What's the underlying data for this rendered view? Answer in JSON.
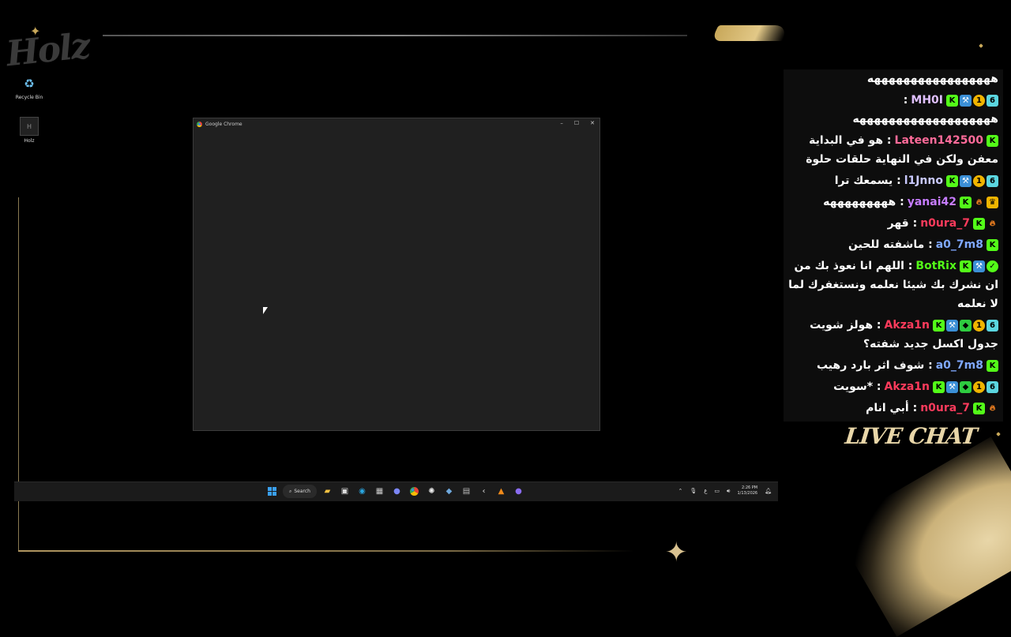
{
  "overlay": {
    "brand": "Holz",
    "live_chat_label": "LIVE CHAT"
  },
  "desktop": {
    "icons": [
      {
        "label": "Recycle Bin",
        "icon": "recycle-bin-icon"
      },
      {
        "label": "Holz",
        "icon": "holz-app-icon"
      }
    ]
  },
  "window": {
    "title": "Google Chrome",
    "controls": [
      "–",
      "☐",
      "✕"
    ]
  },
  "taskbar": {
    "search_label": "Search",
    "apps": [
      "file-explorer-icon",
      "store-icon",
      "edge-icon",
      "calculator-icon",
      "discord-icon",
      "chrome-icon",
      "obs-icon",
      "steam-icon",
      "keyboard-icon",
      "back-icon",
      "app-a-icon",
      "app-circle-icon"
    ],
    "tray_lang": "ع",
    "time": "2:26 PM",
    "date": "1/13/2026"
  },
  "chat": {
    "messages": [
      {
        "badges": [],
        "user": "",
        "user_color": "#ffffff",
        "text": "هههههههههههههههههه"
      },
      {
        "badges": [
          "kick",
          "blue",
          "gold",
          "cyan"
        ],
        "user": "MH0I",
        "user_color": "#e0c0ff",
        "text": "هههههههههههههههههههه"
      },
      {
        "badges": [
          "kick"
        ],
        "user": "Lateen142500",
        "user_color": "#ff6b9a",
        "text": "هو في البداية معفن ولكن في النهاية حلقات حلوة"
      },
      {
        "badges": [
          "kick",
          "blue",
          "gold",
          "cyan"
        ],
        "user": "l1Jnno",
        "user_color": "#c9c9ff",
        "text": "يسمعك ترا"
      },
      {
        "badges": [
          "kick",
          "flame",
          "crown"
        ],
        "user": "yanai42",
        "user_color": "#c77dff",
        "text": "هههههههههه"
      },
      {
        "badges": [
          "kick",
          "flame"
        ],
        "user": "n0ura_7",
        "user_color": "#ff3b5c",
        "text": "قهر"
      },
      {
        "badges": [
          "kick"
        ],
        "user": "a0_7m8",
        "user_color": "#7fa8ff",
        "text": "ماشفته للحين"
      },
      {
        "badges": [
          "kick",
          "blue",
          "shield"
        ],
        "user": "BotRix",
        "user_color": "#53fc18",
        "text": "اللهم انا نعوذ بك من ان نشرك بك شيئا نعلمه ونستغفرك لما لا نعلمه"
      },
      {
        "badges": [
          "kick",
          "blue",
          "green",
          "gold",
          "cyan"
        ],
        "user": "Akza1n",
        "user_color": "#ff3b5c",
        "text": "هولز شويت جدول اكسل جديد شفته؟"
      },
      {
        "badges": [
          "kick"
        ],
        "user": "a0_7m8",
        "user_color": "#7fa8ff",
        "text": "شوف اثر بارد رهيب"
      },
      {
        "badges": [
          "kick",
          "blue",
          "green",
          "gold",
          "cyan"
        ],
        "user": "Akza1n",
        "user_color": "#ff3b5c",
        "text": "*سويت"
      },
      {
        "badges": [
          "kick",
          "flame"
        ],
        "user": "n0ura_7",
        "user_color": "#ff3b5c",
        "text": "أبي انام"
      }
    ]
  }
}
